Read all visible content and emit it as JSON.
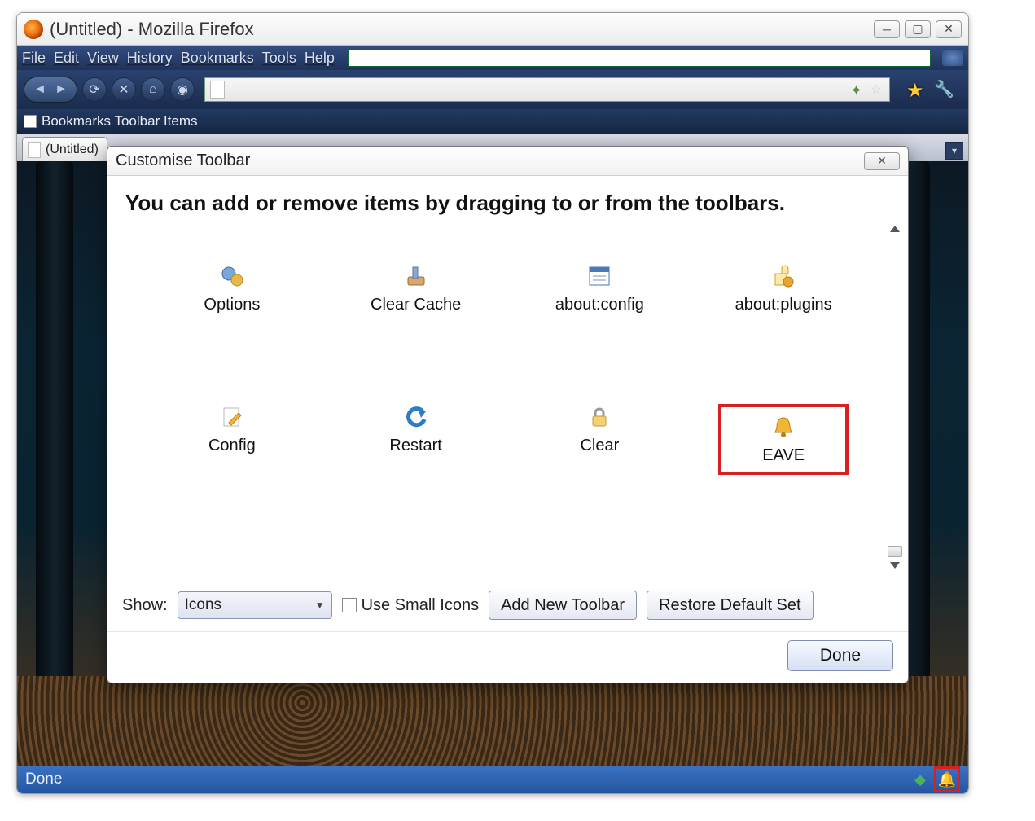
{
  "window": {
    "title": "(Untitled) - Mozilla Firefox"
  },
  "menubar": [
    "File",
    "Edit",
    "View",
    "History",
    "Bookmarks",
    "Tools",
    "Help"
  ],
  "bookmarks_bar": {
    "label": "Bookmarks Toolbar Items"
  },
  "tab": {
    "label": "(Untitled)"
  },
  "status": {
    "text": "Done"
  },
  "dialog": {
    "title": "Customise Toolbar",
    "headline": "You can add or remove items by dragging to or from the toolbars.",
    "items": [
      {
        "label": "Options"
      },
      {
        "label": "Clear Cache"
      },
      {
        "label": "about:config"
      },
      {
        "label": "about:plugins"
      },
      {
        "label": "Config"
      },
      {
        "label": "Restart"
      },
      {
        "label": "Clear"
      },
      {
        "label": "EAVE"
      }
    ],
    "show_label": "Show:",
    "show_value": "Icons",
    "use_small_icons_label": "Use Small Icons",
    "add_toolbar_label": "Add New Toolbar",
    "restore_label": "Restore Default Set",
    "done_label": "Done"
  }
}
